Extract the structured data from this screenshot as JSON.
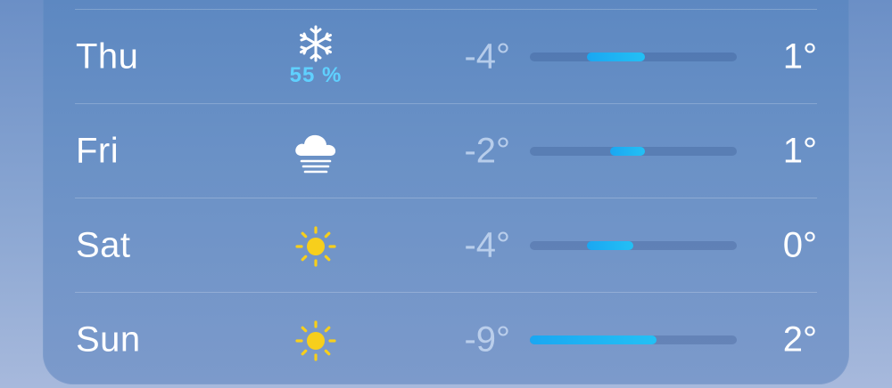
{
  "forecast": {
    "days": [
      {
        "day": "Thu",
        "icon": "snowflake-icon",
        "precip": "55 %",
        "low": "-4°",
        "high": "1°",
        "low_value": -4,
        "high_value": 1
      },
      {
        "day": "Fri",
        "icon": "fog-cloud-icon",
        "precip": "",
        "low": "-2°",
        "high": "1°",
        "low_value": -2,
        "high_value": 1
      },
      {
        "day": "Sat",
        "icon": "sun-icon",
        "precip": "",
        "low": "-4°",
        "high": "0°",
        "low_value": -4,
        "high_value": 0
      },
      {
        "day": "Sun",
        "icon": "sun-icon",
        "precip": "",
        "low": "-9°",
        "high": "2°",
        "low_value": -9,
        "high_value": 2
      }
    ],
    "range_min": -9,
    "range_max": 9
  },
  "colors": {
    "precip": "#5fd0ff",
    "sun": "#f7cf1c",
    "bar": "#1ab0f3"
  }
}
